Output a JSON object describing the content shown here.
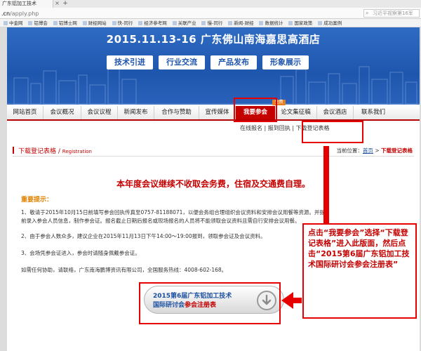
{
  "browser": {
    "tab_title": "广东铝加工技术",
    "tab_close": "×",
    "tab_new": "+",
    "url_host": ".cn",
    "url_path": "/apply.php",
    "search_placeholder": "习近平视察第16军",
    "bookmarks": [
      "中金网",
      "铝博会",
      "铝博士网",
      "财经网站",
      "快-同行",
      "经济参考网",
      "关联产业",
      "慢-同行",
      "新闻-财经",
      "数据统计",
      "国家政策",
      "成功案例"
    ]
  },
  "banner": {
    "title": "2015.11.13-16  广东佛山南海嘉思高酒店",
    "buttons": [
      "技术引进",
      "行业交流",
      "产品发布",
      "形象展示"
    ]
  },
  "nav": {
    "items": [
      "网站首页",
      "会议概况",
      "会议议程",
      "新闻发布",
      "合作与赞助",
      "宣传媒体",
      "我要参会",
      "论文集征稿",
      "会议酒店",
      "联系我们"
    ],
    "free_badge": "免费"
  },
  "subnav": {
    "online": "在线报名",
    "sep1": " | ",
    "review": "报到回执",
    "sep2": " | ",
    "download": "下载登记表格"
  },
  "breadcrumb": {
    "title": "下载登记表格",
    "slash": " / ",
    "title_en": "Registration",
    "loc_label": "当前位置：",
    "home": "首页",
    "arrow": " > ",
    "current": "下载登记表格"
  },
  "content": {
    "headline": "本年度会议继续不收取会务费，住宿及交通费自理。",
    "notice_title": "重要提示：",
    "p1": "1、敬请于2015年10月15日前填写参会回执传真至0757-81188071，以便会务组合理组织会议资料和安排会议用餐等资源。并提前录入参会人员信息，制作参会证。报名截止日期后报名或现场报名的人员将不能领取会议资料且需自行安排会议用餐。",
    "p2": "2、由于参会人数众多，建议企业在2015年11月13日下午14:00～19:00报到，领取参会证及会议资料。",
    "p3": "3、会场凭参会证进入，参会时请随身佩戴参会证。",
    "p4": "如需任何协助，请联络，广东南海鹏博资讯有限公司，全国服务热线：4008-602-168。"
  },
  "download": {
    "line1": "2015第6届广东铝加工技术",
    "line2_a": "国际研讨会",
    "line2_b": "参会注册表"
  },
  "annotation": {
    "text": "点击“我要参会”选择“下载登记表格”进入此版面，然后点击“2015第6届广东铝加工技术国际研讨会参会注册表”"
  },
  "colors": {
    "brand_red": "#c40000",
    "brand_blue": "#1f55ad",
    "annotation_red": "#e60000"
  }
}
